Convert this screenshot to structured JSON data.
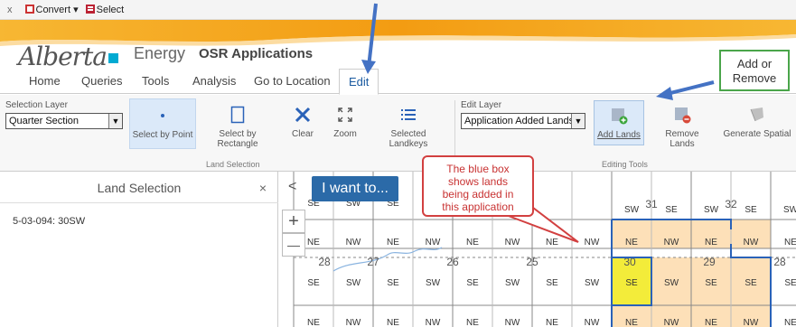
{
  "browser_toolbar": {
    "close": "x",
    "convert": "Convert",
    "select": "Select"
  },
  "header": {
    "brand": "Alberta",
    "ministry": "Energy",
    "app_title": "OSR Applications"
  },
  "menu": {
    "tabs": [
      "Home",
      "Queries",
      "Tools",
      "Analysis",
      "Go to Location",
      "Edit"
    ],
    "active": "Edit"
  },
  "ribbon": {
    "selection_layer_label": "Selection Layer",
    "selection_layer_value": "Quarter Section",
    "land_selection_tools": [
      {
        "label": "Select by Point",
        "icon": "point-icon"
      },
      {
        "label": "Select by\nRectangle",
        "icon": "rectangle-icon"
      },
      {
        "label": "Clear",
        "icon": "clear-x-icon"
      },
      {
        "label": "Zoom",
        "icon": "zoom-extent-icon"
      },
      {
        "label": "Selected\nLandkeys",
        "icon": "list-icon"
      }
    ],
    "land_selection_caption": "Land Selection",
    "edit_layer_label": "Edit Layer",
    "edit_layer_value": "Application Added Lands",
    "editing_tools": [
      {
        "label": "Add Lands",
        "icon": "add-lands-icon"
      },
      {
        "label": "Remove Lands",
        "icon": "remove-lands-icon"
      },
      {
        "label": "Generate Spatial",
        "icon": "generate-spatial-icon"
      }
    ],
    "editing_tools_caption": "Editing Tools"
  },
  "left_panel": {
    "title": "Land Selection",
    "close": "×",
    "items": [
      "5-03-094: 30SW"
    ]
  },
  "map": {
    "i_want_to": "I want to...",
    "zoom_in": "+",
    "zoom_out": "—",
    "collapse": "<",
    "section_numbers": [
      "31",
      "32",
      "33",
      "28",
      "27",
      "26",
      "25",
      "30",
      "29",
      "28"
    ],
    "colors": {
      "highlight": "#fde0b8",
      "selected": "#f3ec3a",
      "outline": "#2a62b8"
    }
  },
  "annotations": {
    "green_callout": "Add or\nRemove",
    "red_callout": "The blue box\nshows lands\nbeing added in\nthis application"
  }
}
